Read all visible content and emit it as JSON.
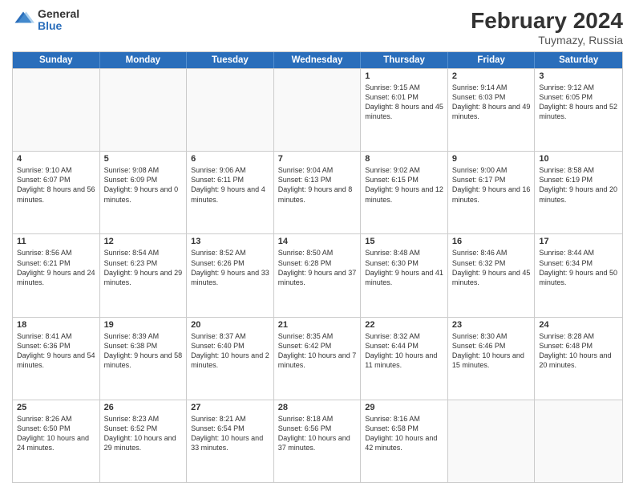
{
  "header": {
    "logo_general": "General",
    "logo_blue": "Blue",
    "month_year": "February 2024",
    "location": "Tuymazy, Russia"
  },
  "weekdays": [
    "Sunday",
    "Monday",
    "Tuesday",
    "Wednesday",
    "Thursday",
    "Friday",
    "Saturday"
  ],
  "weeks": [
    [
      {
        "day": "",
        "info": ""
      },
      {
        "day": "",
        "info": ""
      },
      {
        "day": "",
        "info": ""
      },
      {
        "day": "",
        "info": ""
      },
      {
        "day": "1",
        "info": "Sunrise: 9:15 AM\nSunset: 6:01 PM\nDaylight: 8 hours\nand 45 minutes."
      },
      {
        "day": "2",
        "info": "Sunrise: 9:14 AM\nSunset: 6:03 PM\nDaylight: 8 hours\nand 49 minutes."
      },
      {
        "day": "3",
        "info": "Sunrise: 9:12 AM\nSunset: 6:05 PM\nDaylight: 8 hours\nand 52 minutes."
      }
    ],
    [
      {
        "day": "4",
        "info": "Sunrise: 9:10 AM\nSunset: 6:07 PM\nDaylight: 8 hours\nand 56 minutes."
      },
      {
        "day": "5",
        "info": "Sunrise: 9:08 AM\nSunset: 6:09 PM\nDaylight: 9 hours\nand 0 minutes."
      },
      {
        "day": "6",
        "info": "Sunrise: 9:06 AM\nSunset: 6:11 PM\nDaylight: 9 hours\nand 4 minutes."
      },
      {
        "day": "7",
        "info": "Sunrise: 9:04 AM\nSunset: 6:13 PM\nDaylight: 9 hours\nand 8 minutes."
      },
      {
        "day": "8",
        "info": "Sunrise: 9:02 AM\nSunset: 6:15 PM\nDaylight: 9 hours\nand 12 minutes."
      },
      {
        "day": "9",
        "info": "Sunrise: 9:00 AM\nSunset: 6:17 PM\nDaylight: 9 hours\nand 16 minutes."
      },
      {
        "day": "10",
        "info": "Sunrise: 8:58 AM\nSunset: 6:19 PM\nDaylight: 9 hours\nand 20 minutes."
      }
    ],
    [
      {
        "day": "11",
        "info": "Sunrise: 8:56 AM\nSunset: 6:21 PM\nDaylight: 9 hours\nand 24 minutes."
      },
      {
        "day": "12",
        "info": "Sunrise: 8:54 AM\nSunset: 6:23 PM\nDaylight: 9 hours\nand 29 minutes."
      },
      {
        "day": "13",
        "info": "Sunrise: 8:52 AM\nSunset: 6:26 PM\nDaylight: 9 hours\nand 33 minutes."
      },
      {
        "day": "14",
        "info": "Sunrise: 8:50 AM\nSunset: 6:28 PM\nDaylight: 9 hours\nand 37 minutes."
      },
      {
        "day": "15",
        "info": "Sunrise: 8:48 AM\nSunset: 6:30 PM\nDaylight: 9 hours\nand 41 minutes."
      },
      {
        "day": "16",
        "info": "Sunrise: 8:46 AM\nSunset: 6:32 PM\nDaylight: 9 hours\nand 45 minutes."
      },
      {
        "day": "17",
        "info": "Sunrise: 8:44 AM\nSunset: 6:34 PM\nDaylight: 9 hours\nand 50 minutes."
      }
    ],
    [
      {
        "day": "18",
        "info": "Sunrise: 8:41 AM\nSunset: 6:36 PM\nDaylight: 9 hours\nand 54 minutes."
      },
      {
        "day": "19",
        "info": "Sunrise: 8:39 AM\nSunset: 6:38 PM\nDaylight: 9 hours\nand 58 minutes."
      },
      {
        "day": "20",
        "info": "Sunrise: 8:37 AM\nSunset: 6:40 PM\nDaylight: 10 hours\nand 2 minutes."
      },
      {
        "day": "21",
        "info": "Sunrise: 8:35 AM\nSunset: 6:42 PM\nDaylight: 10 hours\nand 7 minutes."
      },
      {
        "day": "22",
        "info": "Sunrise: 8:32 AM\nSunset: 6:44 PM\nDaylight: 10 hours\nand 11 minutes."
      },
      {
        "day": "23",
        "info": "Sunrise: 8:30 AM\nSunset: 6:46 PM\nDaylight: 10 hours\nand 15 minutes."
      },
      {
        "day": "24",
        "info": "Sunrise: 8:28 AM\nSunset: 6:48 PM\nDaylight: 10 hours\nand 20 minutes."
      }
    ],
    [
      {
        "day": "25",
        "info": "Sunrise: 8:26 AM\nSunset: 6:50 PM\nDaylight: 10 hours\nand 24 minutes."
      },
      {
        "day": "26",
        "info": "Sunrise: 8:23 AM\nSunset: 6:52 PM\nDaylight: 10 hours\nand 29 minutes."
      },
      {
        "day": "27",
        "info": "Sunrise: 8:21 AM\nSunset: 6:54 PM\nDaylight: 10 hours\nand 33 minutes."
      },
      {
        "day": "28",
        "info": "Sunrise: 8:18 AM\nSunset: 6:56 PM\nDaylight: 10 hours\nand 37 minutes."
      },
      {
        "day": "29",
        "info": "Sunrise: 8:16 AM\nSunset: 6:58 PM\nDaylight: 10 hours\nand 42 minutes."
      },
      {
        "day": "",
        "info": ""
      },
      {
        "day": "",
        "info": ""
      }
    ]
  ]
}
